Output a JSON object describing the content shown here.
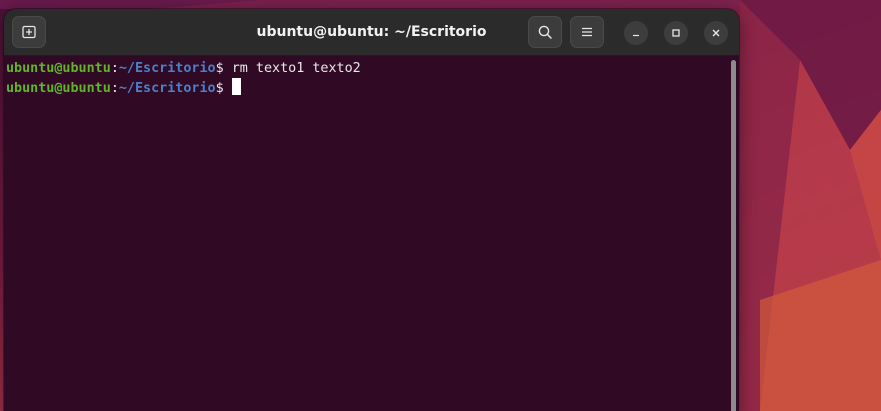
{
  "window": {
    "title": "ubuntu@ubuntu: ~/Escritorio"
  },
  "toolbar": {
    "new_tab_icon": "new-tab-icon",
    "search_icon": "search-icon",
    "menu_icon": "hamburger-menu-icon",
    "minimize_icon": "minimize-icon",
    "maximize_icon": "maximize-icon",
    "close_icon": "close-icon"
  },
  "terminal": {
    "lines": [
      {
        "user": "ubuntu@ubuntu",
        "colon": ":",
        "path": "~/Escritorio",
        "prompt": "$",
        "command": " rm texto1 texto2"
      },
      {
        "user": "ubuntu@ubuntu",
        "colon": ":",
        "path": "~/Escritorio",
        "prompt": "$",
        "command": ""
      }
    ]
  },
  "colors": {
    "terminal_bg": "#300a24",
    "user_green": "#5fb526",
    "path_blue": "#4d7fc9",
    "titlebar_bg": "#2b2b2b"
  }
}
